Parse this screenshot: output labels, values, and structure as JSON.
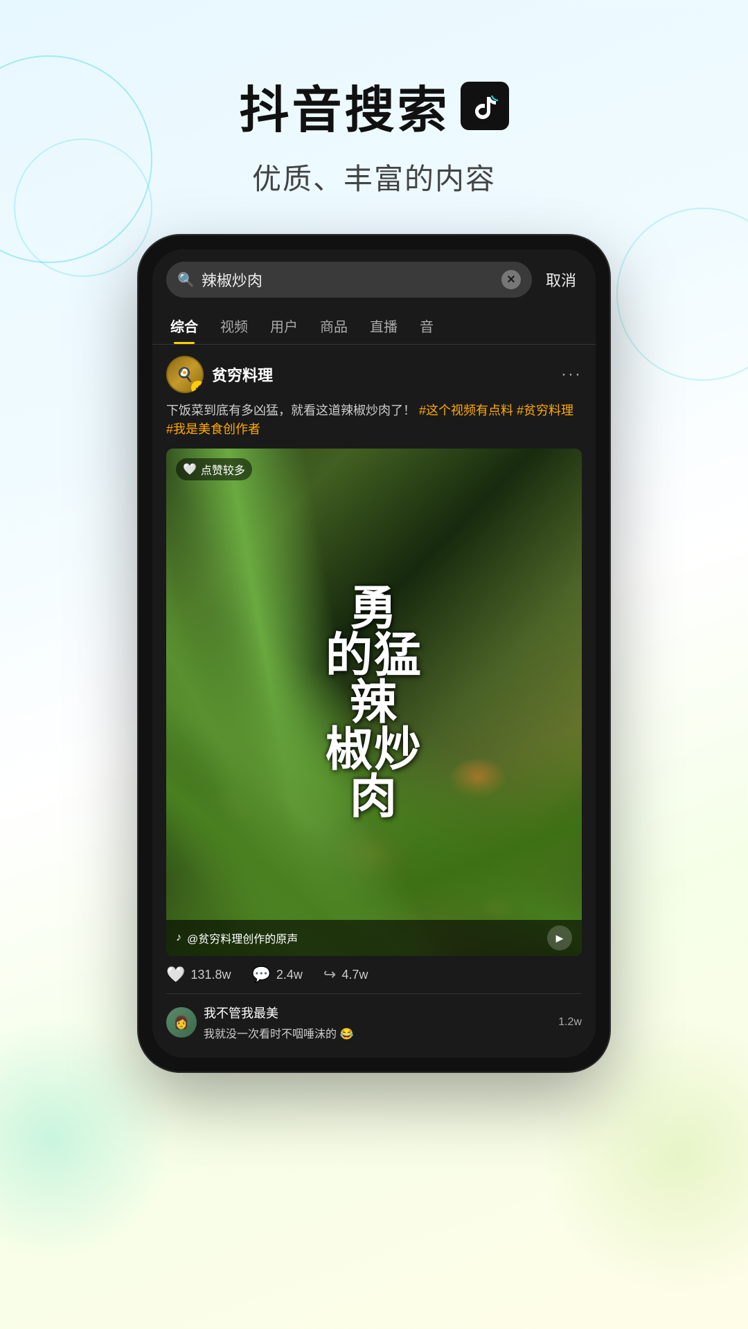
{
  "header": {
    "title": "抖音搜索",
    "logo_symbol": "♪",
    "subtitle": "优质、丰富的内容"
  },
  "phone": {
    "search_bar": {
      "query": "辣椒炒肉",
      "cancel_label": "取消",
      "placeholder": "搜索"
    },
    "tabs": [
      {
        "label": "综合",
        "active": true
      },
      {
        "label": "视频",
        "active": false
      },
      {
        "label": "用户",
        "active": false
      },
      {
        "label": "商品",
        "active": false
      },
      {
        "label": "直播",
        "active": false
      },
      {
        "label": "音",
        "active": false
      }
    ],
    "result_card": {
      "user": {
        "name": "贫穷料理",
        "verified": true
      },
      "description": "下饭菜到底有多凶猛，就看这道辣椒炒肉了！",
      "hashtags": [
        "#这个视频有点料",
        "#贫穷料理",
        "#我是美食创作者"
      ],
      "video": {
        "likes_badge": "点赞较多",
        "big_text_lines": [
          "勇",
          "的猛",
          "辣",
          "椒炒",
          "肉"
        ],
        "audio_label": "@贫穷料理创作的原声"
      },
      "stats": {
        "likes": "131.8w",
        "comments": "2.4w",
        "shares": "4.7w"
      },
      "comment": {
        "user_name": "我不管我最美",
        "text": "我就没一次看时不咽唾沫的 😂",
        "likes": "1.2w"
      }
    }
  },
  "colors": {
    "accent_yellow": "#ffcc00",
    "hashtag_color": "#ffaa00",
    "bg_dark": "#1a1a1a",
    "phone_shell": "#111111"
  }
}
